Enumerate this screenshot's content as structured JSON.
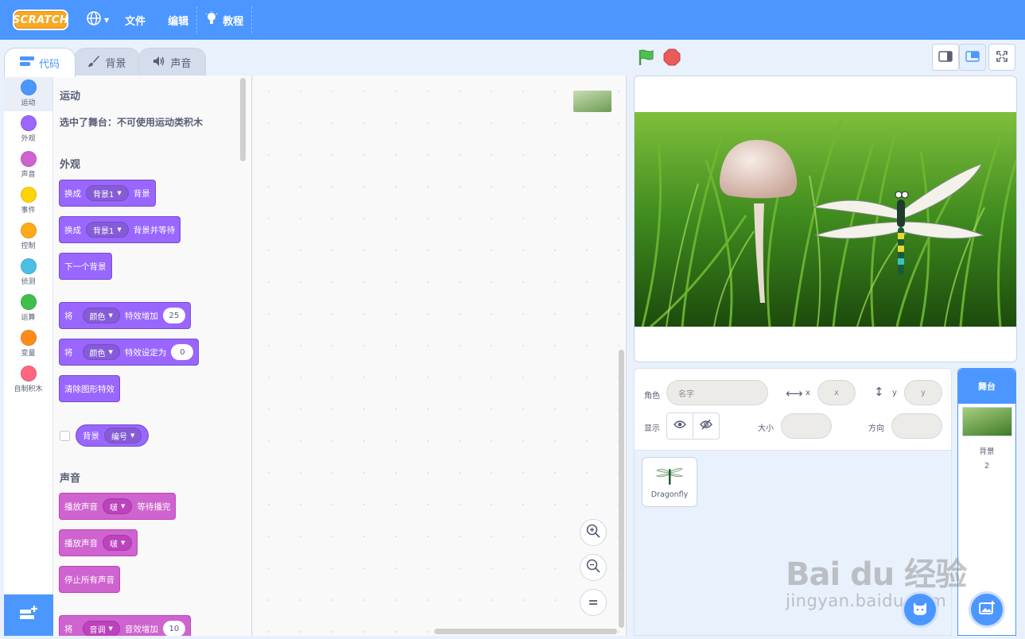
{
  "menubar": {
    "logo": "SCRATCH",
    "file": "文件",
    "edit": "编辑",
    "tutorials": "教程"
  },
  "tabs": [
    {
      "label": "代码"
    },
    {
      "label": "背景"
    },
    {
      "label": "声音"
    }
  ],
  "categories": [
    {
      "label": "运动",
      "color": "#4c97ff"
    },
    {
      "label": "外观",
      "color": "#9966ff"
    },
    {
      "label": "声音",
      "color": "#cf63cf"
    },
    {
      "label": "事件",
      "color": "#ffd500"
    },
    {
      "label": "控制",
      "color": "#ffab19"
    },
    {
      "label": "侦测",
      "color": "#4cbfe6"
    },
    {
      "label": "运算",
      "color": "#40bf4a"
    },
    {
      "label": "变量",
      "color": "#ff8c1a"
    },
    {
      "label": "自制积木",
      "color": "#ff6680"
    }
  ],
  "palette": {
    "motion_head": "运动",
    "motion_note": "选中了舞台：不可使用运动类积木",
    "looks_head": "外观",
    "switch_backdrop": {
      "a": "换成",
      "dd": "背景1",
      "b": "背景"
    },
    "switch_backdrop_wait": {
      "a": "换成",
      "dd": "背景1",
      "b": "背景并等待"
    },
    "next_backdrop": "下一个背景",
    "change_effect": {
      "a": "将",
      "dd": "颜色",
      "b": "特效增加",
      "val": "25"
    },
    "set_effect": {
      "a": "将",
      "dd": "颜色",
      "b": "特效设定为",
      "val": "0"
    },
    "clear_effects": "清除图形特效",
    "backdrop_reporter": {
      "a": "背景",
      "dd": "编号"
    },
    "sound_head": "声音",
    "play_until_done": {
      "a": "播放声音",
      "dd": "啵",
      "b": "等待播完"
    },
    "start_sound": {
      "a": "播放声音",
      "dd": "啵"
    },
    "stop_all_sounds": "停止所有声音",
    "change_sound_effect": {
      "a": "将",
      "dd": "音调",
      "b": "音效增加",
      "val": "10"
    }
  },
  "zoom": {
    "in": "+",
    "out": "−",
    "reset": "="
  },
  "sprite_info": {
    "sprite_label": "角色",
    "name_placeholder": "名字",
    "x_label": "x",
    "x_placeholder": "x",
    "y_label": "y",
    "y_placeholder": "y",
    "show_label": "显示",
    "size_label": "大小",
    "direction_label": "方向"
  },
  "sprites": [
    {
      "name": "Dragonfly"
    }
  ],
  "stage_pane": {
    "title": "舞台",
    "backdrops_label": "背景",
    "backdrops_count": "2"
  },
  "watermark": {
    "line1": "Bai du 经验",
    "line2": "jingyan.baidu.com"
  }
}
